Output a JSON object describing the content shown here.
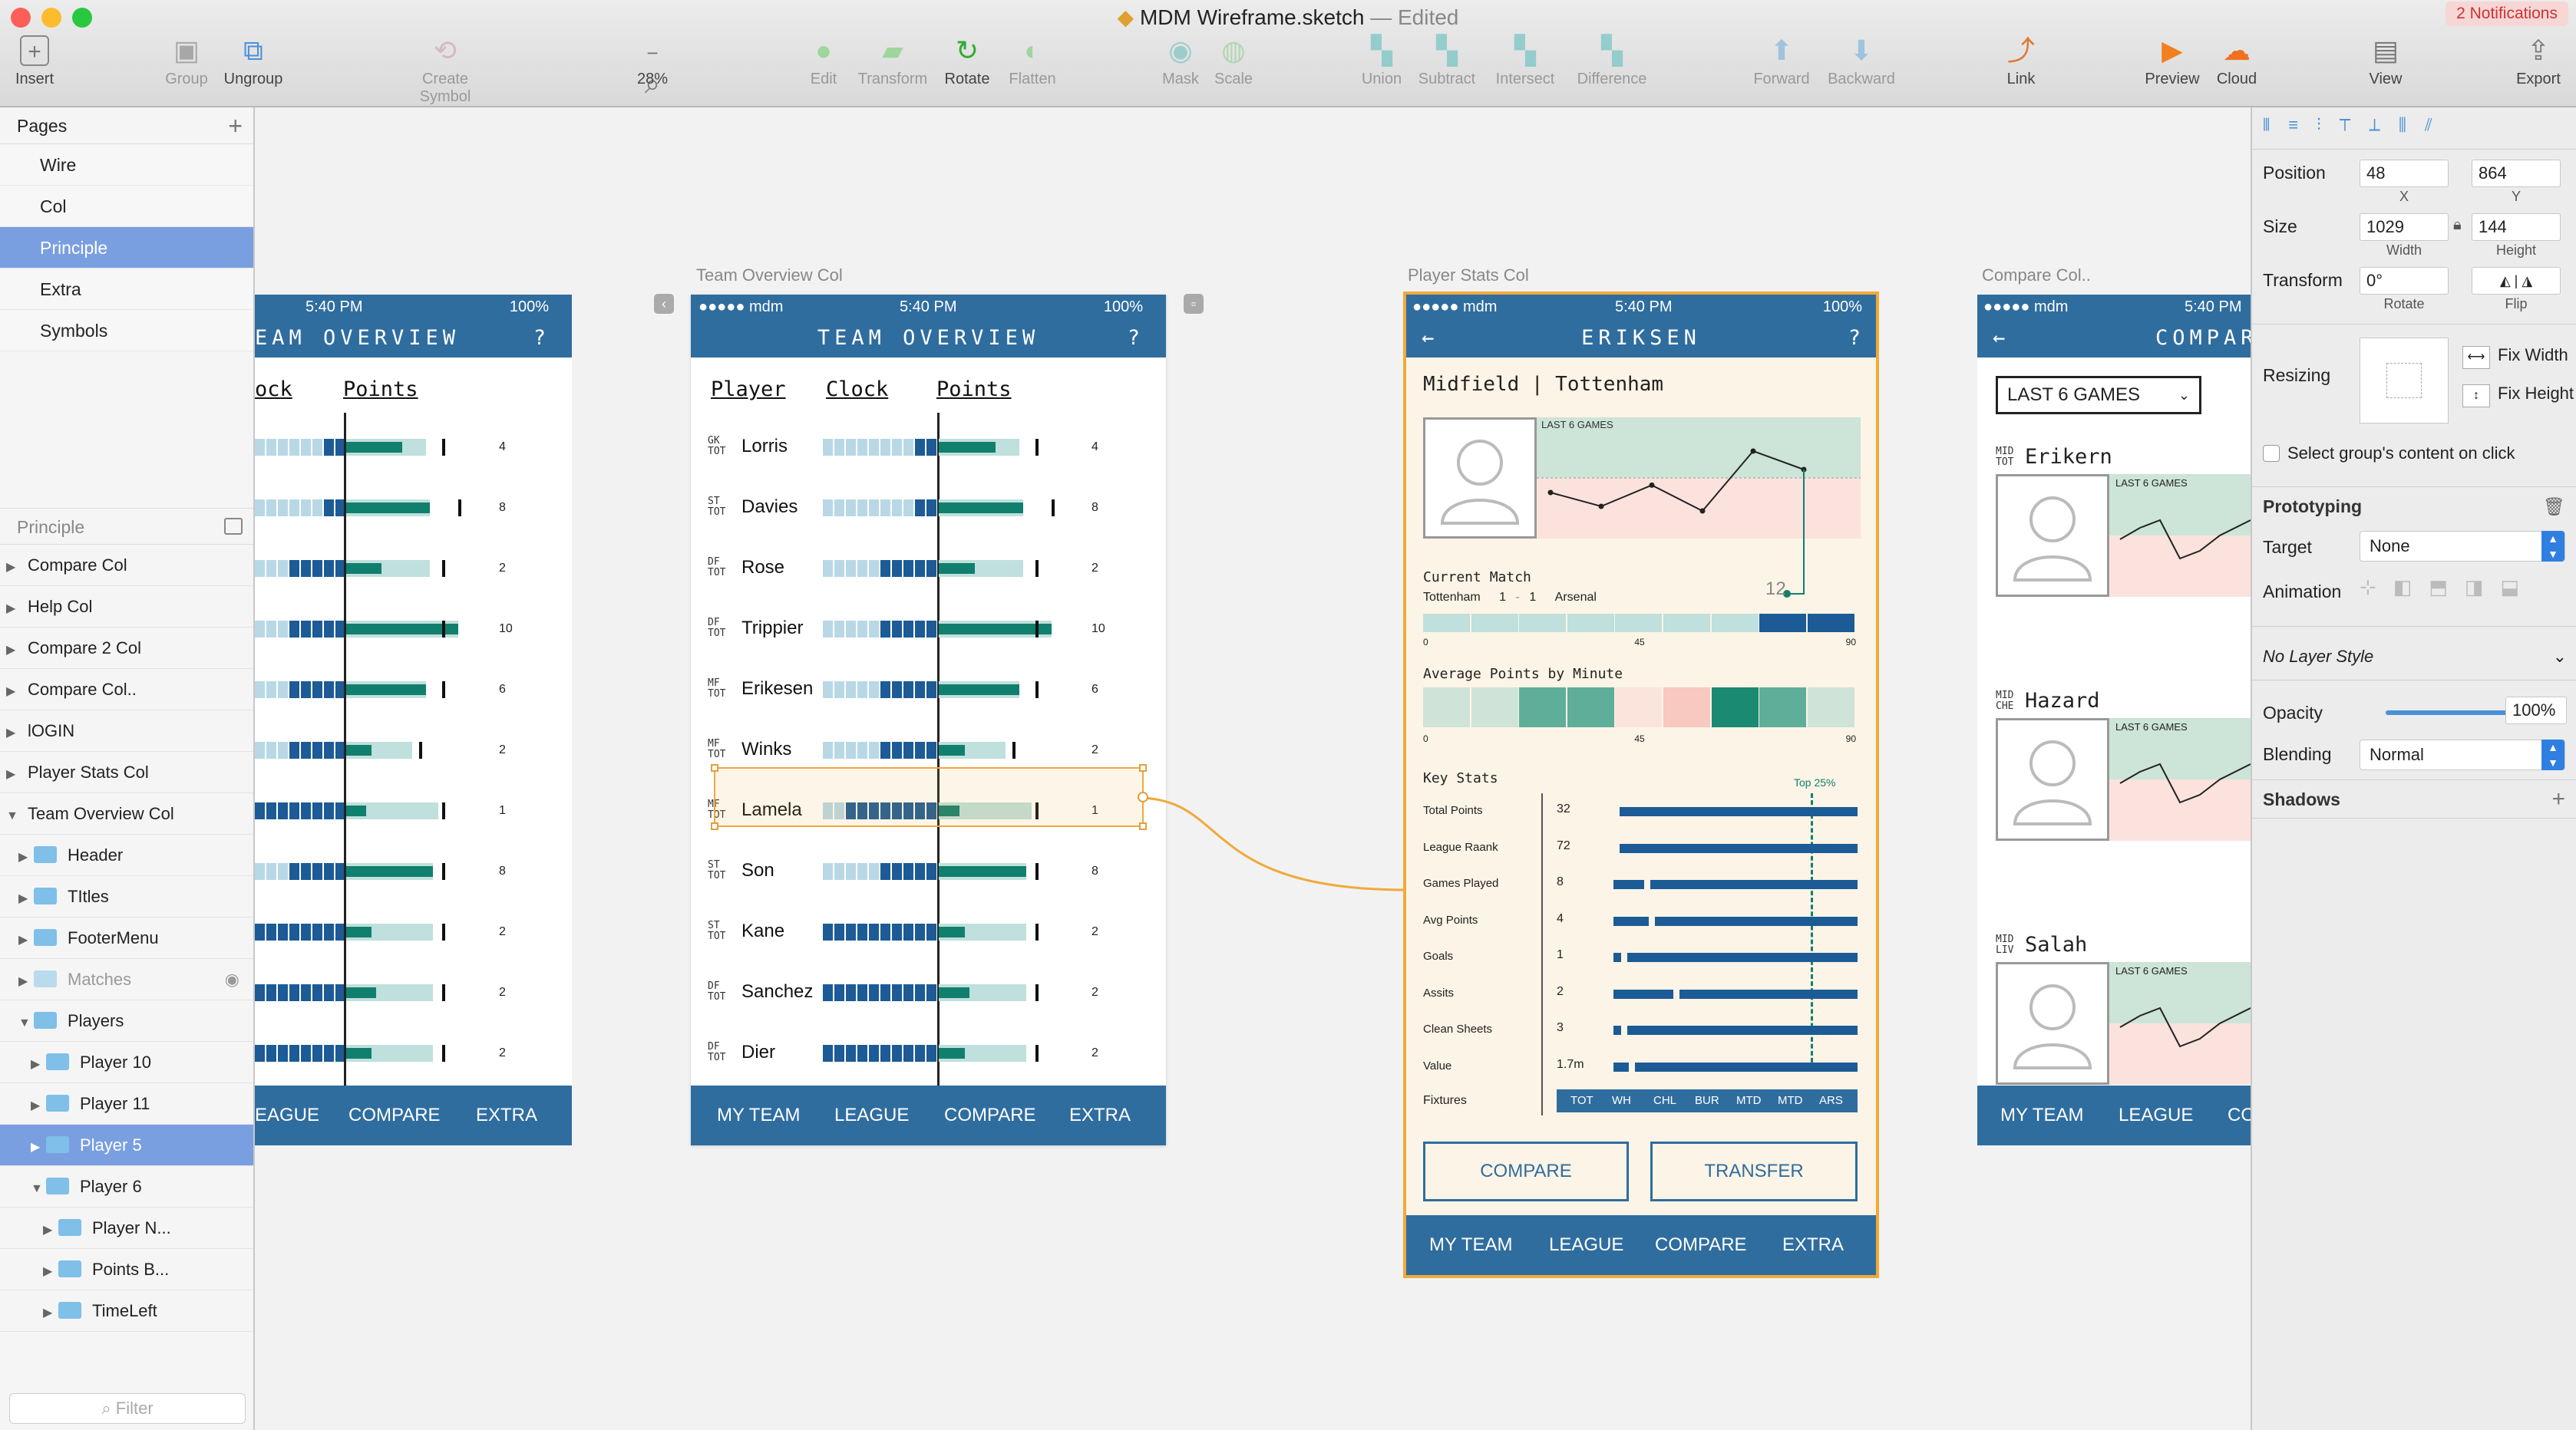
{
  "window": {
    "title": "MDM Wireframe.sketch",
    "edited": "— Edited",
    "notification": "2 Notifications"
  },
  "toolbar": {
    "insert": "Insert",
    "group": "Group",
    "ungroup": "Ungroup",
    "create_symbol": "Create Symbol",
    "zoom": "28%",
    "zoom_minus": "−",
    "zoom_plus": "+",
    "edit": "Edit",
    "transform": "Transform",
    "rotate": "Rotate",
    "flatten": "Flatten",
    "mask": "Mask",
    "scale": "Scale",
    "union": "Union",
    "subtract": "Subtract",
    "intersect": "Intersect",
    "difference": "Difference",
    "forward": "Forward",
    "backward": "Backward",
    "link": "Link",
    "preview": "Preview",
    "cloud": "Cloud",
    "view": "View",
    "export": "Export"
  },
  "pages": {
    "header": "Pages",
    "add": "+",
    "items": [
      "Wire",
      "Col",
      "Principle",
      "Extra",
      "Symbols"
    ],
    "selected": 2
  },
  "layers": {
    "header": "Principle",
    "items": [
      {
        "label": "Compare Col",
        "depth": 0,
        "open": false
      },
      {
        "label": "Help Col",
        "depth": 0,
        "open": false
      },
      {
        "label": "Compare 2 Col",
        "depth": 0,
        "open": false
      },
      {
        "label": "Compare Col..",
        "depth": 0,
        "open": false
      },
      {
        "label": "lOGIN",
        "depth": 0,
        "open": false
      },
      {
        "label": "Player Stats Col",
        "depth": 0,
        "open": false
      },
      {
        "label": "Team Overview Col",
        "depth": 0,
        "open": true
      },
      {
        "label": "Header",
        "depth": 1,
        "open": false,
        "folder": true
      },
      {
        "label": "TItles",
        "depth": 1,
        "open": false,
        "folder": true
      },
      {
        "label": "FooterMenu",
        "depth": 1,
        "open": false,
        "folder": true
      },
      {
        "label": "Matches",
        "depth": 1,
        "open": false,
        "folder": true,
        "hidden": true
      },
      {
        "label": "Players",
        "depth": 1,
        "open": true,
        "folder": true
      },
      {
        "label": "Player 10",
        "depth": 2,
        "open": false,
        "folder": true
      },
      {
        "label": "Player 11",
        "depth": 2,
        "open": false,
        "folder": true
      },
      {
        "label": "Player 5",
        "depth": 2,
        "open": false,
        "folder": true,
        "selected": true
      },
      {
        "label": "Player 6",
        "depth": 2,
        "open": true,
        "folder": true
      },
      {
        "label": "Player N...",
        "depth": 3,
        "open": false,
        "folder": true
      },
      {
        "label": "Points B...",
        "depth": 3,
        "open": false,
        "folder": true
      },
      {
        "label": "TimeLeft",
        "depth": 3,
        "open": false,
        "folder": true
      }
    ],
    "filter_placeholder": "Filter"
  },
  "artboards": {
    "team_overview": {
      "label": "Team Overview Col",
      "status": {
        "carrier": "●●●●● mdm",
        "time": "5:40 PM",
        "battery": "100%"
      },
      "title": "TEAM OVERVIEW",
      "help": "?",
      "headers": {
        "player": "Player",
        "clock": "Clock",
        "points": "Points"
      },
      "players": [
        {
          "pos": "GK",
          "team": "TOT",
          "name": "Lorris",
          "clock": 0.2,
          "points": 0.55,
          "bg": 0.78,
          "tick": 0.94,
          "value": "4"
        },
        {
          "pos": "ST",
          "team": "TOT",
          "name": "Davies",
          "clock": 0.2,
          "points": 0.82,
          "bg": 0.82,
          "tick": 1.1,
          "value": "8"
        },
        {
          "pos": "DF",
          "team": "TOT",
          "name": "Rose",
          "clock": 0.5,
          "points": 0.35,
          "bg": 0.82,
          "tick": 0.94,
          "value": "2"
        },
        {
          "pos": "DF",
          "team": "TOT",
          "name": "Trippier",
          "clock": 0.5,
          "points": 1.1,
          "bg": 1.1,
          "tick": 0.94,
          "value": "10"
        },
        {
          "pos": "MF",
          "team": "TOT",
          "name": "Erikesen",
          "clock": 0.5,
          "points": 0.78,
          "bg": 0.78,
          "tick": 0.94,
          "value": "6"
        },
        {
          "pos": "MF",
          "team": "TOT",
          "name": "Winks",
          "clock": 0.5,
          "points": 0.25,
          "bg": 0.65,
          "tick": 0.72,
          "value": "2"
        },
        {
          "pos": "MF",
          "team": "TOT",
          "name": "Lamela",
          "clock": 0.75,
          "points": 0.2,
          "bg": 0.9,
          "tick": 0.94,
          "value": "1"
        },
        {
          "pos": "ST",
          "team": "TOT",
          "name": "Son",
          "clock": 0.5,
          "points": 0.85,
          "bg": 0.85,
          "tick": 0.94,
          "value": "8"
        },
        {
          "pos": "ST",
          "team": "TOT",
          "name": "Kane",
          "clock": 1.0,
          "points": 0.25,
          "bg": 0.85,
          "tick": 0.94,
          "value": "2"
        },
        {
          "pos": "DF",
          "team": "TOT",
          "name": "Sanchez",
          "clock": 1.0,
          "points": 0.3,
          "bg": 0.85,
          "tick": 0.94,
          "value": "2"
        },
        {
          "pos": "DF",
          "team": "TOT",
          "name": "Dier",
          "clock": 1.0,
          "points": 0.25,
          "bg": 0.85,
          "tick": 0.94,
          "value": "2"
        }
      ],
      "tabs": [
        "MY TEAM",
        "LEAGUE",
        "COMPARE",
        "EXTRA"
      ]
    },
    "player_stats": {
      "label": "Player Stats Col",
      "status": {
        "carrier": "●●●●● mdm",
        "time": "5:40 PM",
        "battery": "100%"
      },
      "title": "ERIKSEN",
      "back": "←",
      "help": "?",
      "subtitle": "Midfield | Tottenham",
      "chart_label": "LAST 6 GAMES",
      "line_values": [
        0.5,
        0.35,
        0.58,
        0.3,
        0.95,
        0.75
      ],
      "current_points": "12",
      "current_match": "Current Match",
      "match": {
        "home": "Tottenham",
        "home_score": "1",
        "dash": "-",
        "away_score": "1",
        "away": "Arsenal"
      },
      "minute_ticks": [
        "0",
        "45",
        "90"
      ],
      "match_fill": 0.68,
      "avg_title": "Average Points by Minute",
      "heat": [
        "#cfe3d9",
        "#cfe3d9",
        "#5fae9a",
        "#5fae9a",
        "#fbe4dc",
        "#f7c9c0",
        "#1a8a73",
        "#5fae9a",
        "#cfe3d9"
      ],
      "key_stats": "Key Stats",
      "top_label": "Top 25%",
      "stats": [
        {
          "label": "Total Points",
          "value": "32",
          "fill": 1.0
        },
        {
          "label": "League Raank",
          "value": "72",
          "fill": 1.0
        },
        {
          "label": "Games Played",
          "value": "8",
          "fill": 1.0
        },
        {
          "label": "Avg Points",
          "value": "4",
          "fill": 1.0
        },
        {
          "label": "Goals",
          "value": "1",
          "fill": 1.0
        },
        {
          "label": "Assits",
          "value": "2",
          "fill": 1.0
        },
        {
          "label": "Clean Sheets",
          "value": "3",
          "fill": 1.0
        },
        {
          "label": "Value",
          "value": "1.7m",
          "fill": 1.0
        }
      ],
      "fixtures_label": "Fixtures",
      "fixtures": [
        "TOT",
        "WH",
        "CHL",
        "BUR",
        "MTD",
        "MTD",
        "ARS"
      ],
      "compare_btn": "COMPARE",
      "transfer_btn": "TRANSFER",
      "tabs": [
        "MY TEAM",
        "LEAGUE",
        "COMPARE",
        "EXTRA"
      ]
    },
    "compare": {
      "label": "Compare Col..",
      "status": {
        "carrier": "●●●●● mdm",
        "time": "5:40 PM"
      },
      "title": "COMPAR",
      "back": "←",
      "dropdown": "LAST 6 GAMES",
      "players": [
        {
          "pos": "MID",
          "team": "TOT",
          "name": "Erikern"
        },
        {
          "pos": "MID",
          "team": "CHE",
          "name": "Hazard"
        },
        {
          "pos": "MID",
          "team": "LIV",
          "name": "Salah"
        }
      ],
      "chart_label": "LAST 6 GAMES",
      "tabs": [
        "MY TEAM",
        "LEAGUE",
        "CO"
      ]
    },
    "partial": {
      "status": {
        "time": "5:40 PM",
        "battery": "100%"
      },
      "title": "EAM OVERVIEW",
      "help": "?",
      "headers": {
        "clock": "ock",
        "points": "Points"
      },
      "tabs": [
        "EAGUE",
        "COMPARE",
        "EXTRA"
      ]
    }
  },
  "inspector": {
    "position": {
      "label": "Position",
      "x": "48",
      "y": "864",
      "x_label": "X",
      "y_label": "Y"
    },
    "size": {
      "label": "Size",
      "w": "1029",
      "h": "144",
      "w_label": "Width",
      "h_label": "Height"
    },
    "transform": {
      "label": "Transform",
      "rotate": "0°",
      "rotate_label": "Rotate",
      "flip_label": "Flip"
    },
    "resizing": {
      "label": "Resizing",
      "fix_width": "Fix Width",
      "fix_height": "Fix Height"
    },
    "select_group": "Select group's content on click",
    "prototyping": "Prototyping",
    "target": {
      "label": "Target",
      "value": "None"
    },
    "animation": "Animation",
    "layer_style": "No Layer Style",
    "opacity": {
      "label": "Opacity",
      "value": "100%",
      "level": 1.0
    },
    "blending": {
      "label": "Blending",
      "value": "Normal"
    },
    "shadows": "Shadows",
    "add": "+"
  },
  "colors": {
    "primary": "#2f6d9f",
    "accent": "#117f6e",
    "selection": "#7a9fe0",
    "highlight": "#f0a93b"
  }
}
